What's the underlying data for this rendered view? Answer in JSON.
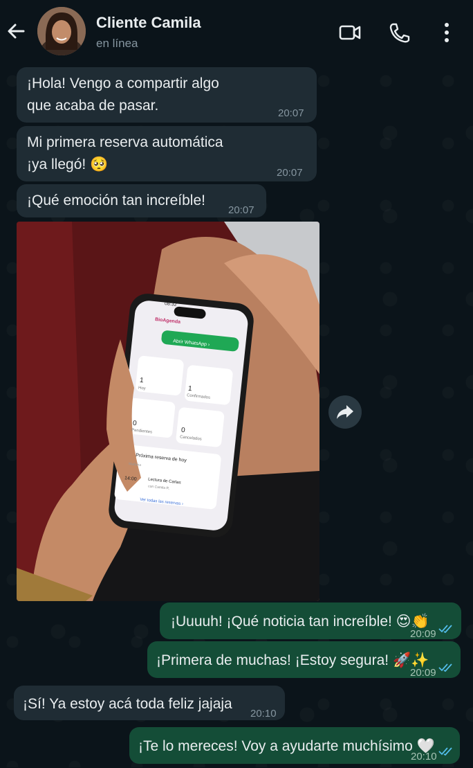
{
  "header": {
    "contact_name": "Cliente Camila",
    "status": "en línea",
    "icons": [
      "back-arrow-icon",
      "avatar",
      "video-call-icon",
      "phone-call-icon",
      "more-options-icon"
    ]
  },
  "messages": [
    {
      "dir": "in",
      "lines": [
        "¡Hola! Vengo a compartir algo",
        "que acaba de pasar."
      ],
      "time": "20:07"
    },
    {
      "dir": "in",
      "lines": [
        "Mi primera reserva automática",
        "¡ya llegó! 🥺"
      ],
      "time": "20:07"
    },
    {
      "dir": "in",
      "lines": [
        "¡Qué emoción tan increíble!"
      ],
      "time": "20:07"
    },
    {
      "dir": "in",
      "type": "image"
    },
    {
      "dir": "out",
      "lines": [
        "¡Uuuuh! ¡Qué noticia tan increíble! 😍👏"
      ],
      "time": "20:09"
    },
    {
      "dir": "out",
      "lines": [
        "¡Primera de muchas! ¡Estoy segura! 🚀✨"
      ],
      "time": "20:09"
    },
    {
      "dir": "in",
      "lines": [
        "¡Sí! Ya estoy acá toda feliz jajaja"
      ],
      "time": "20:10"
    },
    {
      "dir": "out",
      "lines": [
        "¡Te lo mereces! Voy a ayudarte muchísimo 🤍"
      ],
      "time": "20:10"
    }
  ],
  "photo_phone": {
    "clock": "08:32",
    "app_name": "BioAgenda",
    "whatsapp_button": "Abrir WhatsApp ›",
    "stats": [
      {
        "value": "1",
        "label": "Hoy"
      },
      {
        "value": "1",
        "label": "Confirmados"
      },
      {
        "value": "0",
        "label": "Pendientes"
      },
      {
        "value": "0",
        "label": "Cancelados"
      }
    ],
    "next_title": "Próxima reserva de hoy",
    "next_sub": "Mañana",
    "next_time": "14:00",
    "next_service": "Lectura de Cartas",
    "next_client": "con Camila R.",
    "see_all": "Ver todas las reservas ›"
  },
  "colors": {
    "background": "#0b141a",
    "incoming": "#1f2c34",
    "outgoing": "#144d37",
    "read_ticks": "#53bdeb"
  }
}
